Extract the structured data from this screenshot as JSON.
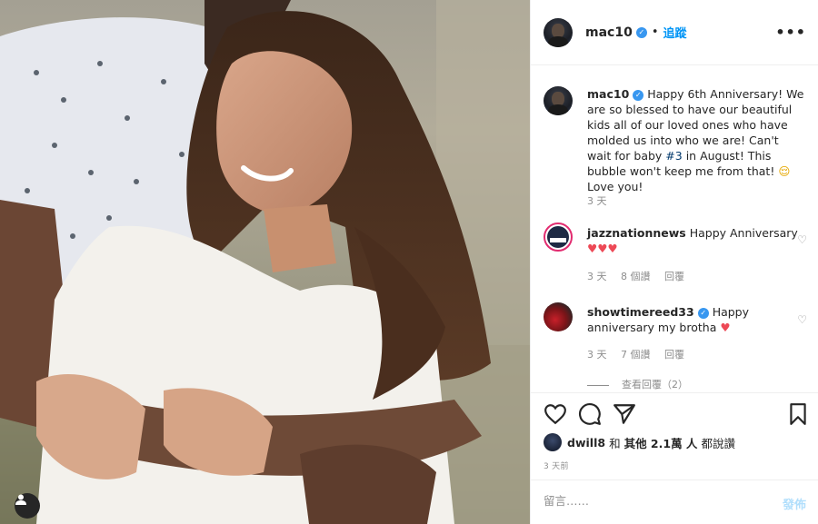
{
  "header": {
    "username": "mac10",
    "dot": "•",
    "follow_label": "追蹤",
    "more_label": "•••"
  },
  "caption": {
    "username": "mac10",
    "text_before": "Happy 6th Anniversary! We are so blessed to have our beautiful kids all of our loved ones who have molded us into who we are! Can't wait for baby ",
    "hashtag": "#3",
    "text_after": " in August! This bubble won't keep me from that! ",
    "emoji": "😌",
    "text_end": " Love you!",
    "time": "3 天"
  },
  "comments": [
    {
      "username": "jazznationnews",
      "text": "Happy Anniversary",
      "emoji": "♥♥♥",
      "time": "3 天",
      "likes": "8 個讚",
      "reply": "回覆"
    },
    {
      "username": "showtimereed33",
      "text": "Happy anniversary my brotha",
      "emoji": "♥",
      "time": "3 天",
      "likes": "7 個讚",
      "reply": "回覆"
    }
  ],
  "view_replies": "查看回覆（2）",
  "likes_line": {
    "user": "dwill8",
    "and": "和",
    "others": "其他 2.1萬 人",
    "suffix": "都說讚"
  },
  "date": "3 天前",
  "comment_input": {
    "placeholder": "留言……"
  },
  "post_label": "發佈",
  "icons": {
    "like": "heart-icon",
    "comment": "comment-icon",
    "share": "share-icon",
    "save": "bookmark-icon",
    "tag": "user-tag-icon"
  },
  "colors": {
    "link_blue": "#0095f6",
    "verified": "#3897f0",
    "heart_red": "#ed4956",
    "muted": "#8e8e8e"
  }
}
